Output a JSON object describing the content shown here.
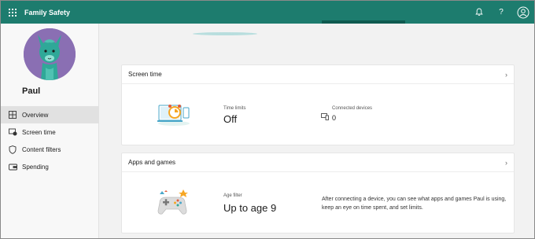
{
  "header": {
    "app_title": "Family Safety",
    "icons": [
      "waffle-icon",
      "bell-icon",
      "help-icon",
      "account-icon"
    ],
    "help_glyph": "?"
  },
  "profile": {
    "name": "Paul"
  },
  "sidebar": {
    "items": [
      {
        "label": "Overview",
        "icon": "overview-icon",
        "active": true
      },
      {
        "label": "Screen time",
        "icon": "screen-time-icon",
        "active": false
      },
      {
        "label": "Content filters",
        "icon": "shield-icon",
        "active": false
      },
      {
        "label": "Spending",
        "icon": "wallet-icon",
        "active": false
      }
    ]
  },
  "screen_time": {
    "title": "Screen time",
    "time_limits_label": "Time limits",
    "time_limits_value": "Off",
    "connected_devices_label": "Connected devices",
    "connected_devices_value": "0"
  },
  "apps_games": {
    "title": "Apps and games",
    "age_filter_label": "Age filter",
    "age_filter_value": "Up to age 9",
    "description": "After connecting a device, you can see what apps and games Paul is using, keep an eye on time spent, and set limits."
  },
  "colors": {
    "brand": "#1d7c6e",
    "brand_dark": "#0f5b50",
    "avatar_bg": "#8a6fb3",
    "llama": "#2fa898"
  }
}
